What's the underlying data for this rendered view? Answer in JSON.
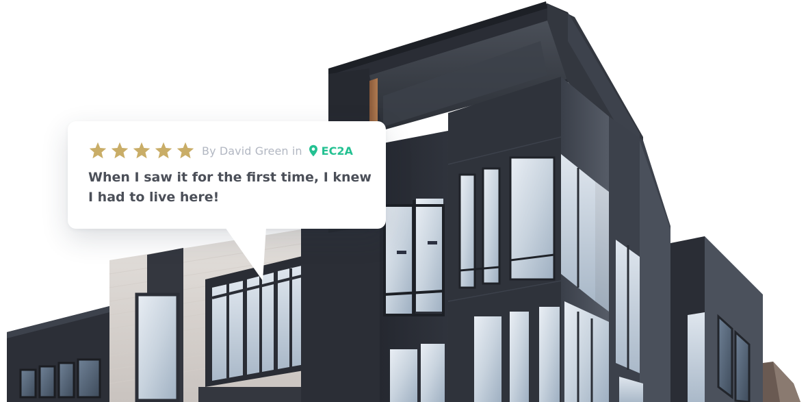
{
  "review": {
    "rating": 5,
    "max_rating": 5,
    "byline": "By David Green in",
    "location_code": "EC2A",
    "quote": "When I saw it for the first time, I knew I had to live here!"
  },
  "colors": {
    "star": "#c9ad67",
    "location": "#24c192",
    "byline": "#b2b7c2",
    "quote": "#4b4f58",
    "building_panel": "#2a2d35"
  },
  "icons": {
    "rating": "star-icon",
    "location": "map-pin-icon"
  }
}
